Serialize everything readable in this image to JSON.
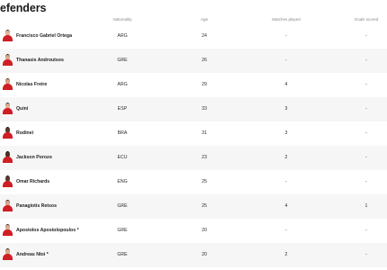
{
  "section": {
    "title": "efenders"
  },
  "columns": {
    "nationality": "Nationality",
    "age": "Age",
    "matches": "Matches played",
    "goals": "Goals scored"
  },
  "players": [
    {
      "name": "Francisco Gabriel Ortega",
      "nationality": "ARG",
      "age": "24",
      "matches": "-",
      "goals": "-",
      "skin": "#e2b49a",
      "hair": "#3a2a20"
    },
    {
      "name": "Thanasis Androutsos",
      "nationality": "GRE",
      "age": "26",
      "matches": "-",
      "goals": "-",
      "skin": "#d9a88c",
      "hair": "#2a1d16"
    },
    {
      "name": "Nicolas Freire",
      "nationality": "ARG",
      "age": "29",
      "matches": "4",
      "goals": "-",
      "skin": "#d7a085",
      "hair": "#3b2b21"
    },
    {
      "name": "Quini",
      "nationality": "ESP",
      "age": "33",
      "matches": "3",
      "goals": "-",
      "skin": "#dfae92",
      "hair": "#2e2018"
    },
    {
      "name": "Rodinei",
      "nationality": "BRA",
      "age": "31",
      "matches": "3",
      "goals": "-",
      "skin": "#5a3a2a",
      "hair": "#1c120d"
    },
    {
      "name": "Jackson Porozo",
      "nationality": "ECU",
      "age": "23",
      "matches": "2",
      "goals": "-",
      "skin": "#4a3024",
      "hair": "#140c08"
    },
    {
      "name": "Omar Richards",
      "nationality": "ENG",
      "age": "25",
      "matches": "-",
      "goals": "-",
      "skin": "#5b3b2b",
      "hair": "#1a100b"
    },
    {
      "name": "Panagiotis Retsos",
      "nationality": "GRE",
      "age": "25",
      "matches": "4",
      "goals": "1",
      "skin": "#d8a486",
      "hair": "#2d1f17"
    },
    {
      "name": "Apostolos Apostolopoulos *",
      "nationality": "GRE",
      "age": "20",
      "matches": "-",
      "goals": "-",
      "skin": "#dcae93",
      "hair": "#33251c"
    },
    {
      "name": "Andreas Ntoi *",
      "nationality": "GRE",
      "age": "20",
      "matches": "2",
      "goals": "-",
      "skin": "#d9a98c",
      "hair": "#2c1e16"
    }
  ]
}
